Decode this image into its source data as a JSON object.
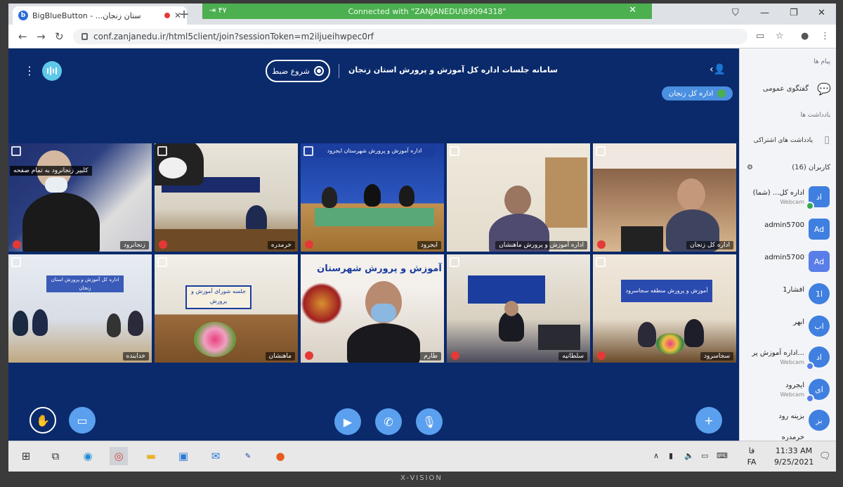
{
  "browser": {
    "tab_title": "BigBlueButton - ...ستان زنجان",
    "new_tab": "+",
    "connected_text": "Connected with \"ZANJANEDU\\89094318\"",
    "connected_left": "⇥  ۴۷",
    "url": "conf.zanjanedu.ir/html5client/join?sessionToken=m2iljueihwpec0rf"
  },
  "bbb": {
    "record_label": "شروع ضبط",
    "meeting_title": "سامانه جلسات اداره کل آموزش و پرورش استان زنجان",
    "presenter": "اداره کل زنجان"
  },
  "tiles": [
    {
      "name": "زنجانرود",
      "tooltip": "کلیپر زنجانرود به تمام صفحه"
    },
    {
      "name": "خرمدره"
    },
    {
      "name": "ایجرود",
      "banner": "اداره آموزش و پرورش شهرستان ایجرود"
    },
    {
      "name": "اداره آموزش و پرورش ماهنشان"
    },
    {
      "name": "اداره کل زنجان"
    },
    {
      "name": "خدابنده",
      "banner": "اداره کل آموزش و پرورش استان زنجان"
    },
    {
      "name": "ماهنشان",
      "banner": "جلسه شورای آموزش و پرورش"
    },
    {
      "name": "طارم",
      "banner": "آموزش و پرورش شهرستان طارم"
    },
    {
      "name": "سلطانیه"
    },
    {
      "name": "سجاسرود",
      "banner": "آموزش و پرورش منطقه سجاسرود"
    }
  ],
  "sidebar": {
    "messages_label": "پیام ها",
    "public_chat": "گفتگوی عمومی",
    "notes_label": "یادداشت ها",
    "shared_notes": "یادداشت های اشتراکی",
    "users_label": "کاربران (16)",
    "users": [
      {
        "initials": "اد",
        "name": "اداره کل... (شما)",
        "sub": "Webcam"
      },
      {
        "initials": "Ad",
        "name": "admin5700",
        "sub": ""
      },
      {
        "initials": "Ad",
        "name": "admin5700",
        "sub": ""
      },
      {
        "initials": "ا1",
        "name": "1افشار",
        "sub": ""
      },
      {
        "initials": "اب",
        "name": "ابهر",
        "sub": ""
      },
      {
        "initials": "اد",
        "name": "اداره آموزش پر...",
        "sub": "Webcam"
      },
      {
        "initials": "ای",
        "name": "ایجرود",
        "sub": "Webcam"
      },
      {
        "initials": "بز",
        "name": "بزینه رود",
        "sub": ""
      },
      {
        "initials": "خر",
        "name": "خرمدره",
        "sub": ""
      }
    ]
  },
  "taskbar": {
    "lang_top": "فا",
    "lang": "FA",
    "time": "11:33 AM",
    "date": "9/25/2021"
  },
  "bezel": "X-VISION",
  "colors": {
    "bbb_blue": "#0a2a6b",
    "accent": "#5aa0ee",
    "connected_green": "#4caf50"
  }
}
